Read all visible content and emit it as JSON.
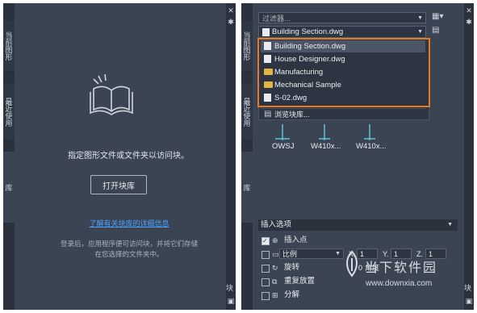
{
  "left": {
    "tabs": [
      {
        "label": "当前图形"
      },
      {
        "label": "最近使用"
      },
      {
        "label": "库"
      }
    ],
    "hint": "指定图形文件或文件夹以访问块。",
    "open_button": "打开块库",
    "help_link": "了解有关块库的详细信息",
    "note": [
      "登录后，应用程序便可访问块，并将它们存储",
      "在您选择的文件夹中。"
    ],
    "rightbar_label": "块"
  },
  "right": {
    "tabs": [
      {
        "label": "当前图形"
      },
      {
        "label": "最近使用"
      },
      {
        "label": "库"
      }
    ],
    "filter_placeholder": "过滤器...",
    "selected_library": "Building Section.dwg",
    "dropdown_items": [
      {
        "label": "Building Section.dwg",
        "icon": "file-icon",
        "selected": true
      },
      {
        "label": "House Designer.dwg",
        "icon": "file-icon",
        "selected": false
      },
      {
        "label": "Manufacturing",
        "icon": "folder-icon",
        "selected": false
      },
      {
        "label": "Mechanical Sample",
        "icon": "folder-icon",
        "selected": false
      },
      {
        "label": "S-02.dwg",
        "icon": "file-icon",
        "selected": false
      }
    ],
    "browse_label": "浏览块库...",
    "blocks": [
      {
        "label": "OWSJ"
      },
      {
        "label": "W410x..."
      },
      {
        "label": "W410x..."
      }
    ],
    "insert_options_title": "插入选项",
    "options": {
      "insert_point": "插入点",
      "scale": "比例",
      "scale_value": "比例",
      "x_label": "X.",
      "x_value": "1",
      "y_label": "Y.",
      "y_value": "1",
      "z_label": "Z.",
      "z_value": "1",
      "rotate": "旋转",
      "angle_value": "0",
      "angle_label": "角度",
      "repeat": "重复放置",
      "explode": "分解"
    },
    "rightbar_label": "块"
  },
  "watermark": {
    "text1": "当下软件园",
    "text2": "www.downxia.com"
  },
  "colors": {
    "panel": "#3b4453",
    "highlight": "#e47a22",
    "link": "#4aa3ff",
    "folder": "#e2b741"
  }
}
